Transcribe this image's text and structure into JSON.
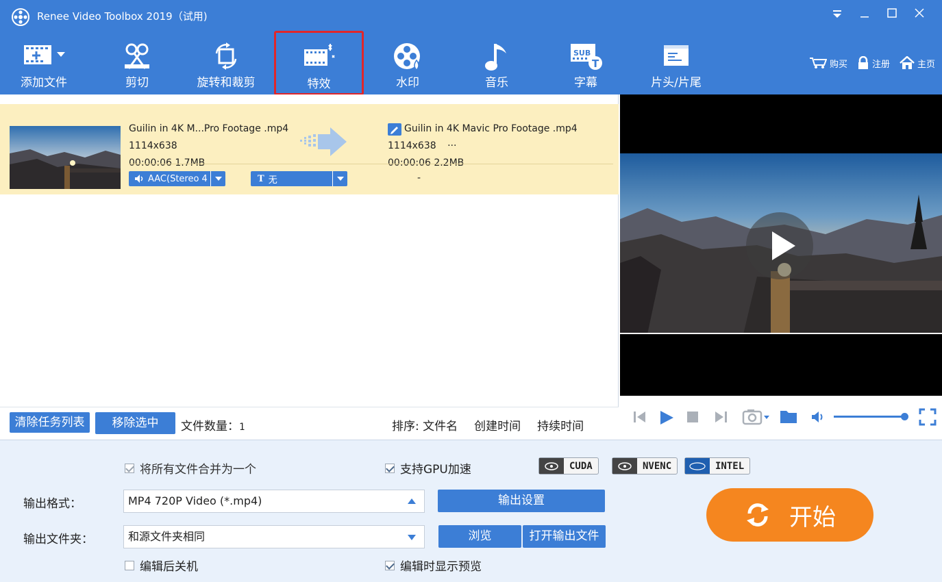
{
  "window": {
    "title": "Renee Video Toolbox 2019（试用)"
  },
  "toolbar": {
    "items": [
      {
        "label": "添加文件",
        "icon": "add-file-icon"
      },
      {
        "label": "剪切",
        "icon": "scissors-icon"
      },
      {
        "label": "旋转和裁剪",
        "icon": "rotate-crop-icon"
      },
      {
        "label": "特效",
        "icon": "effects-icon",
        "selected": true
      },
      {
        "label": "水印",
        "icon": "watermark-icon"
      },
      {
        "label": "音乐",
        "icon": "music-icon"
      },
      {
        "label": "字幕",
        "icon": "subtitle-icon"
      },
      {
        "label": "片头/片尾",
        "icon": "intro-outro-icon"
      }
    ],
    "links": {
      "buy": "购买",
      "register": "注册",
      "home": "主页"
    }
  },
  "file": {
    "source": {
      "name": "Guilin in 4K M...Pro Footage .mp4",
      "resolution": "1114x638",
      "duration_size": "00:00:06 1.7MB"
    },
    "output": {
      "name": "Guilin in 4K Mavic Pro Footage .mp4",
      "resolution": "1114x638",
      "extra": "···",
      "duration_size": "00:00:06 2.2MB"
    },
    "audio": "AAC(Stereo 4",
    "subtitle": "无",
    "dash": "-"
  },
  "listbar": {
    "clear_label": "清除任务列表",
    "remove_label": "移除选中",
    "count_label": "文件数量：",
    "count_value": "1",
    "sort_label": "排序: 文件名",
    "sort_created": "创建时间",
    "sort_duration": "持续时间"
  },
  "settings": {
    "merge_label": "将所有文件合并为一个",
    "merge_checked": true,
    "gpu_label": "支持GPU加速",
    "gpu_checked": true,
    "badges": [
      "CUDA",
      "NVENC",
      "INTEL"
    ],
    "format_label": "输出格式：",
    "format_value": "MP4 720P Video (*.mp4)",
    "output_settings_label": "输出设置",
    "folder_label": "输出文件夹：",
    "folder_value": "和源文件夹相同",
    "browse_label": "浏览",
    "open_output_label": "打开输出文件",
    "shutdown_label": "编辑后关机",
    "shutdown_checked": false,
    "preview_label": "编辑时显示预览",
    "preview_checked": true,
    "start_label": "开始"
  },
  "colors": {
    "accent": "#3c7ed6",
    "highlight": "#fcefc0",
    "start": "#f5861f",
    "selection": "#e1262a"
  }
}
